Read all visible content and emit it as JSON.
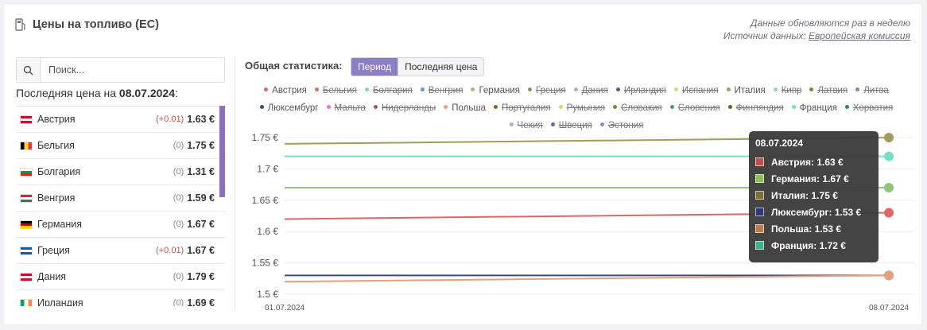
{
  "header": {
    "title": "Цены на топливо (ЕС)",
    "note_line1": "Данные обновляются раз в неделю",
    "note_prefix": "Источник данных: ",
    "note_link": "Европейская комиссия"
  },
  "search": {
    "placeholder": "Поиск..."
  },
  "last_price": {
    "label": "Последняя цена на ",
    "date": "08.07.2024",
    "suffix": ":"
  },
  "countries": [
    {
      "name": "Австрия",
      "delta": "(+0.01)",
      "price": "1.63 €",
      "up": true,
      "flag": [
        "#c8102e",
        "#ffffff",
        "#c8102e"
      ],
      "dir": "h"
    },
    {
      "name": "Бельгия",
      "delta": "(0)",
      "price": "1.75 €",
      "up": false,
      "flag": [
        "#000000",
        "#fdda24",
        "#ef3340"
      ],
      "dir": "v"
    },
    {
      "name": "Болгария",
      "delta": "(0)",
      "price": "1.31 €",
      "up": false,
      "flag": [
        "#ffffff",
        "#00966e",
        "#d62612"
      ],
      "dir": "h"
    },
    {
      "name": "Венгрия",
      "delta": "(0)",
      "price": "1.59 €",
      "up": false,
      "flag": [
        "#ce2939",
        "#ffffff",
        "#477050"
      ],
      "dir": "h"
    },
    {
      "name": "Германия",
      "delta": "(0)",
      "price": "1.67 €",
      "up": false,
      "flag": [
        "#000000",
        "#dd0000",
        "#ffce00"
      ],
      "dir": "h"
    },
    {
      "name": "Греция",
      "delta": "(+0.01)",
      "price": "1.67 €",
      "up": true,
      "flag": [
        "#0d5eaf",
        "#ffffff",
        "#0d5eaf"
      ],
      "dir": "h"
    },
    {
      "name": "Дания",
      "delta": "(0)",
      "price": "1.79 €",
      "up": false,
      "flag": [
        "#c8102e",
        "#ffffff",
        "#c8102e"
      ],
      "dir": "h"
    },
    {
      "name": "Ирландия",
      "delta": "(0)",
      "price": "1.69 €",
      "up": false,
      "flag": [
        "#169b62",
        "#ffffff",
        "#ff883e"
      ],
      "dir": "v"
    }
  ],
  "stats": {
    "label": "Общая статистика:",
    "btn_period": "Период",
    "btn_last": "Последняя цена"
  },
  "legend": [
    {
      "name": "Австрия",
      "color": "#e06666",
      "active": true
    },
    {
      "name": "Бельгия",
      "color": "#c27c5c",
      "active": false
    },
    {
      "name": "Болгария",
      "color": "#76d7c4",
      "active": false
    },
    {
      "name": "Венгрия",
      "color": "#5b9bd5",
      "active": false
    },
    {
      "name": "Германия",
      "color": "#93c47d",
      "active": true
    },
    {
      "name": "Греция",
      "color": "#6aa84f",
      "active": false
    },
    {
      "name": "Дания",
      "color": "#b4a7d6",
      "active": false
    },
    {
      "name": "Ирландия",
      "color": "#674ea7",
      "active": false
    },
    {
      "name": "Испания",
      "color": "#d9d27a",
      "active": false
    },
    {
      "name": "Италия",
      "color": "#a69a5a",
      "active": true
    },
    {
      "name": "Кипр",
      "color": "#7fe0b0",
      "active": false
    },
    {
      "name": "Латвия",
      "color": "#6e8b3d",
      "active": false
    },
    {
      "name": "Литва",
      "color": "#8e7cc3",
      "active": false
    },
    {
      "name": "Люксембург",
      "color": "#3d4a7a",
      "active": true
    },
    {
      "name": "Мальта",
      "color": "#e27ab0",
      "active": false
    },
    {
      "name": "Нидерланды",
      "color": "#a64d79",
      "active": false
    },
    {
      "name": "Польша",
      "color": "#e6a07a",
      "active": true
    },
    {
      "name": "Португалия",
      "color": "#8e5a3c",
      "active": false
    },
    {
      "name": "Румыния",
      "color": "#c5e06a",
      "active": false
    },
    {
      "name": "Словакия",
      "color": "#7f7f3f",
      "active": false
    },
    {
      "name": "Словения",
      "color": "#4c9a6a",
      "active": false
    },
    {
      "name": "Финляндия",
      "color": "#556b2f",
      "active": false
    },
    {
      "name": "Франция",
      "color": "#76e0c2",
      "active": true
    },
    {
      "name": "Хорватия",
      "color": "#3f7f5f",
      "active": false
    },
    {
      "name": "Чехия",
      "color": "#8fb8de",
      "active": false
    },
    {
      "name": "Швеция",
      "color": "#4a6fa5",
      "active": false
    },
    {
      "name": "Эстония",
      "color": "#9b7fc0",
      "active": false
    }
  ],
  "chart_data": {
    "type": "line",
    "x": [
      "01.07.2024",
      "08.07.2024"
    ],
    "ylim": [
      1.5,
      1.75
    ],
    "yticks": [
      "1.75 €",
      "1.7 €",
      "1.65 €",
      "1.6 €",
      "1.55 €",
      "1.5 €"
    ],
    "ytick_values": [
      1.75,
      1.7,
      1.65,
      1.6,
      1.55,
      1.5
    ],
    "grid": true,
    "series": [
      {
        "name": "Австрия",
        "color": "#e06666",
        "values": [
          1.62,
          1.63
        ]
      },
      {
        "name": "Германия",
        "color": "#93c47d",
        "values": [
          1.67,
          1.67
        ]
      },
      {
        "name": "Италия",
        "color": "#a69a5a",
        "values": [
          1.74,
          1.75
        ]
      },
      {
        "name": "Люксембург",
        "color": "#3d4a7a",
        "values": [
          1.53,
          1.53
        ]
      },
      {
        "name": "Польша",
        "color": "#e6a07a",
        "values": [
          1.52,
          1.53
        ]
      },
      {
        "name": "Франция",
        "color": "#76e0c2",
        "values": [
          1.72,
          1.72
        ]
      }
    ]
  },
  "tooltip": {
    "title": "08.07.2024",
    "rows": [
      {
        "label": "Австрия: 1.63 €",
        "color": "#c0504d"
      },
      {
        "label": "Германия: 1.67 €",
        "color": "#8cc152"
      },
      {
        "label": "Италия: 1.75 €",
        "color": "#7d6f35"
      },
      {
        "label": "Люксембург: 1.53 €",
        "color": "#2e3a7a"
      },
      {
        "label": "Польша: 1.53 €",
        "color": "#c07a4a"
      },
      {
        "label": "Франция: 1.72 €",
        "color": "#3fb08c"
      }
    ]
  }
}
